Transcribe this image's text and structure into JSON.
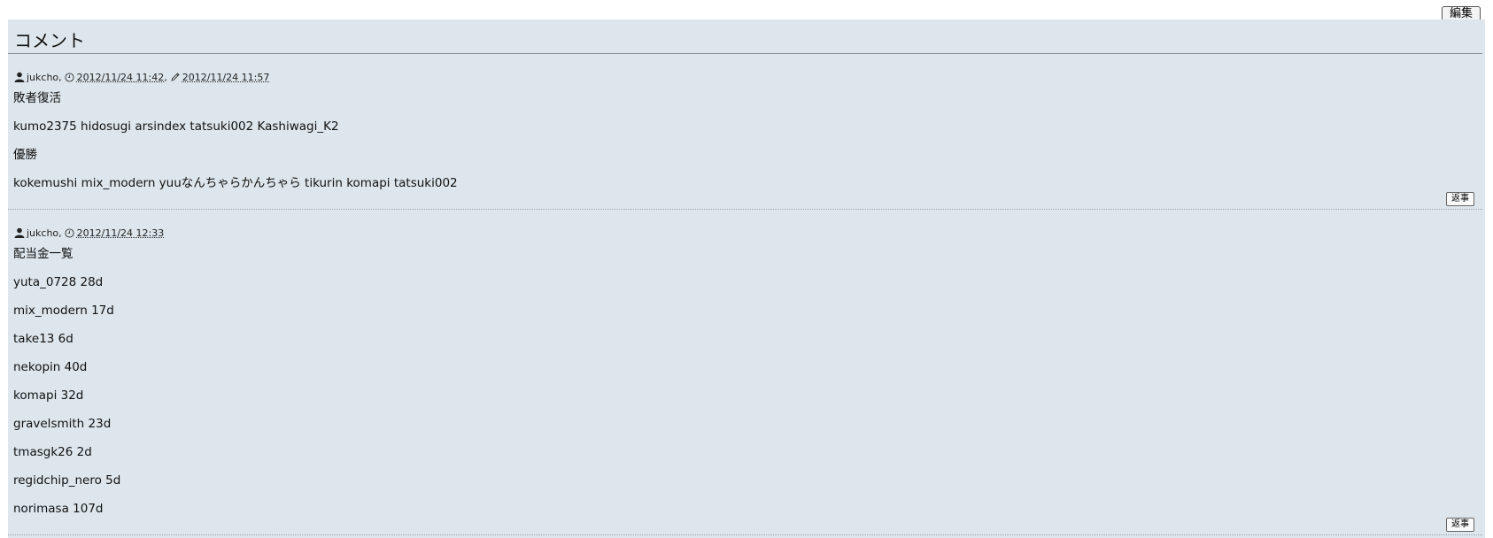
{
  "toolbar": {
    "edit_label": "編集"
  },
  "comments_section": {
    "title": "コメント",
    "reply_label": "返事",
    "comments": [
      {
        "author": "jukcho",
        "posted": "2012/11/24 11:42",
        "edited": "2012/11/24 11:57",
        "lines": [
          "敗者復活",
          "kumo2375 hidosugi arsindex tatsuki002 Kashiwagi_K2",
          "優勝",
          "kokemushi mix_modern yuuなんちゃらかんちゃら tikurin komapi tatsuki002"
        ]
      },
      {
        "author": "jukcho",
        "posted": "2012/11/24 12:33",
        "lines": [
          "配当金一覧",
          "yuta_0728 28d",
          "mix_modern 17d",
          "take13 6d",
          "nekopin 40d",
          "komapi 32d",
          "gravelsmith 23d",
          "tmasgk26 2d",
          "regidchip_nero 5d",
          "norimasa 107d"
        ]
      }
    ]
  }
}
